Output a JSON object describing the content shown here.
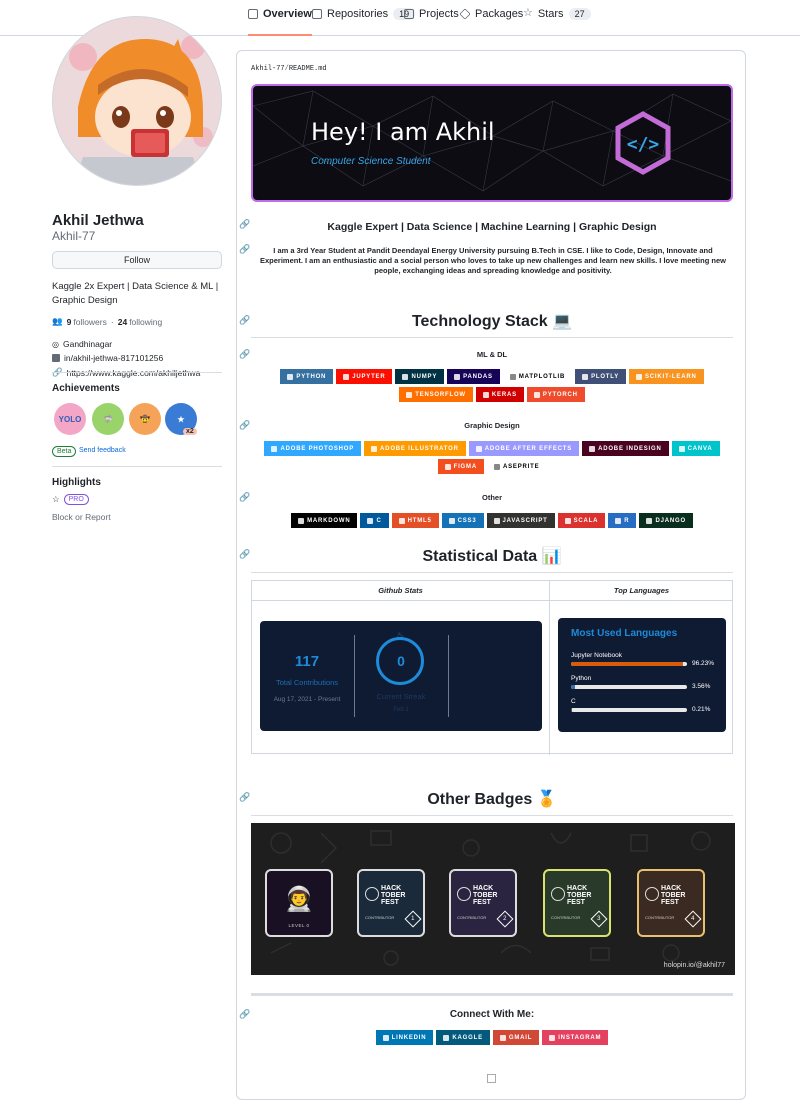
{
  "nav": {
    "tabs": [
      {
        "label": "Overview",
        "count": ""
      },
      {
        "label": "Repositories",
        "count": "19"
      },
      {
        "label": "Projects",
        "count": ""
      },
      {
        "label": "Packages",
        "count": ""
      },
      {
        "label": "Stars",
        "count": "27"
      }
    ]
  },
  "profile": {
    "name": "Akhil Jethwa",
    "login": "Akhil-77",
    "follow_label": "Follow",
    "bio": "Kaggle 2x Expert | Data Science & ML | Graphic Design",
    "followers_count": "9",
    "followers_label": "followers",
    "following_count": "24",
    "following_label": "following",
    "dot": "·",
    "location": "Gandhinagar",
    "linkedin": "in/akhil-jethwa-817101256",
    "website": "https://www.kaggle.com/akhiljethwa"
  },
  "achievements": {
    "title": "Achievements",
    "items": [
      {
        "icon": "yolo-badge-icon",
        "text": "YOLO",
        "color": "#f3a6c6"
      },
      {
        "icon": "pull-shark-badge-icon",
        "text": "",
        "color": "#9ad36a"
      },
      {
        "icon": "quickdraw-badge-icon",
        "text": "",
        "color": "#f6a35a"
      },
      {
        "icon": "starstruck-badge-icon",
        "text": "",
        "color": "#3a7bd5",
        "multiplier": "x2"
      }
    ],
    "beta_label": "Beta",
    "feedback_label": "Send feedback"
  },
  "highlights": {
    "title": "Highlights",
    "pro_label": "PRO",
    "block_label": "Block or Report"
  },
  "readme": {
    "path_user": "Akhil-77",
    "path_sep": "/",
    "path_file": "README.md",
    "banner_title": "Hey! I am Akhil",
    "banner_subtitle": "Computer Science Student",
    "tagline": "Kaggle Expert | Data Science | Machine Learning | Graphic Design",
    "intro": "I am a 3rd Year Student at Pandit Deendayal Energy University pursuing B.Tech in CSE. I like to Code, Design, Innovate and Experiment. I am an enthusiastic and a social person who loves to take up new challenges and learn new skills. I love meeting new people, exchanging ideas and spreading knowledge and positivity.",
    "tech_heading": "Technology Stack 💻",
    "ml_heading": "ML & DL",
    "ml_badges": [
      {
        "label": "PYTHON",
        "color": "#3670a0"
      },
      {
        "label": "JUPYTER",
        "color": "#fa0f00"
      },
      {
        "label": "NUMPY",
        "color": "#013243"
      },
      {
        "label": "PANDAS",
        "color": "#150458"
      },
      {
        "label": "MATPLOTLIB",
        "color": "#ffffff",
        "text_color": "#000000"
      },
      {
        "label": "PLOTLY",
        "color": "#3f4f75"
      },
      {
        "label": "SCIKIT-LEARN",
        "color": "#f7931e"
      },
      {
        "label": "TENSORFLOW",
        "color": "#ff6f00"
      },
      {
        "label": "KERAS",
        "color": "#d00000"
      },
      {
        "label": "PYTORCH",
        "color": "#ee4c2c"
      }
    ],
    "design_heading": "Graphic Design",
    "design_badges": [
      {
        "label": "ADOBE PHOTOSHOP",
        "color": "#31a8ff"
      },
      {
        "label": "ADOBE ILLUSTRATOR",
        "color": "#ff9a00"
      },
      {
        "label": "ADOBE AFTER EFFECTS",
        "color": "#9999ff"
      },
      {
        "label": "ADOBE INDESIGN",
        "color": "#49021f"
      },
      {
        "label": "CANVA",
        "color": "#00c4cc"
      },
      {
        "label": "FIGMA",
        "color": "#f24e1e"
      },
      {
        "label": "ASEPRITE",
        "color": "#ffffff",
        "text_color": "#000000"
      }
    ],
    "other_heading": "Other",
    "other_badges": [
      {
        "label": "MARKDOWN",
        "color": "#000000"
      },
      {
        "label": "C",
        "color": "#00599c"
      },
      {
        "label": "HTML5",
        "color": "#e34f26"
      },
      {
        "label": "CSS3",
        "color": "#1572b6"
      },
      {
        "label": "JAVASCRIPT",
        "color": "#323330"
      },
      {
        "label": "SCALA",
        "color": "#dc322f"
      },
      {
        "label": "R",
        "color": "#276dc3"
      },
      {
        "label": "DJANGO",
        "color": "#092e20"
      }
    ],
    "stats_heading": "Statistical Data 📊",
    "stats_col1": "Github Stats",
    "stats_col2": "Top Languages",
    "streak": {
      "total_value": "117",
      "total_label": "Total Contributions",
      "total_range": "Aug 17, 2021 - Present",
      "current_value": "0",
      "current_label": "Current Streak",
      "current_range": "Feb 1"
    },
    "languages": {
      "title": "Most Used Languages",
      "items": [
        {
          "name": "Jupyter Notebook",
          "percent": "96.23%",
          "fraction": 0.9623,
          "color": "#da5b0b"
        },
        {
          "name": "Python",
          "percent": "3.56%",
          "fraction": 0.0356,
          "color": "#3572a5"
        },
        {
          "name": "C",
          "percent": "0.21%",
          "fraction": 0.0021,
          "color": "#555555"
        }
      ]
    },
    "badges_heading": "Other Badges 🏅",
    "holopin_handle": "holopin.io/@akhil77",
    "holopin_cards": [
      {
        "icon": "astronaut-badge-icon",
        "caption": "LEVEL 0"
      },
      {
        "icon": "hacktoberfest-badge-icon",
        "title": "HACK TOBER FEST",
        "caption": "CONTRIBUTOR",
        "level": "1"
      },
      {
        "icon": "hacktoberfest-badge-icon",
        "title": "HACK TOBER FEST",
        "caption": "CONTRIBUTOR",
        "level": "2"
      },
      {
        "icon": "hacktoberfest-badge-icon",
        "title": "HACK TOBER FEST",
        "caption": "CONTRIBUTOR",
        "level": "3"
      },
      {
        "icon": "hacktoberfest-badge-icon",
        "title": "HACK TOBER FEST",
        "caption": "CONTRIBUTOR",
        "level": "4"
      }
    ],
    "connect_heading": "Connect With Me:",
    "connect_badges": [
      {
        "label": "LINKEDIN",
        "color": "#0077b5"
      },
      {
        "label": "KAGGLE",
        "color": "#035a7d"
      },
      {
        "label": "GMAIL",
        "color": "#d14836"
      },
      {
        "label": "INSTAGRAM",
        "color": "#e4405f"
      }
    ]
  }
}
